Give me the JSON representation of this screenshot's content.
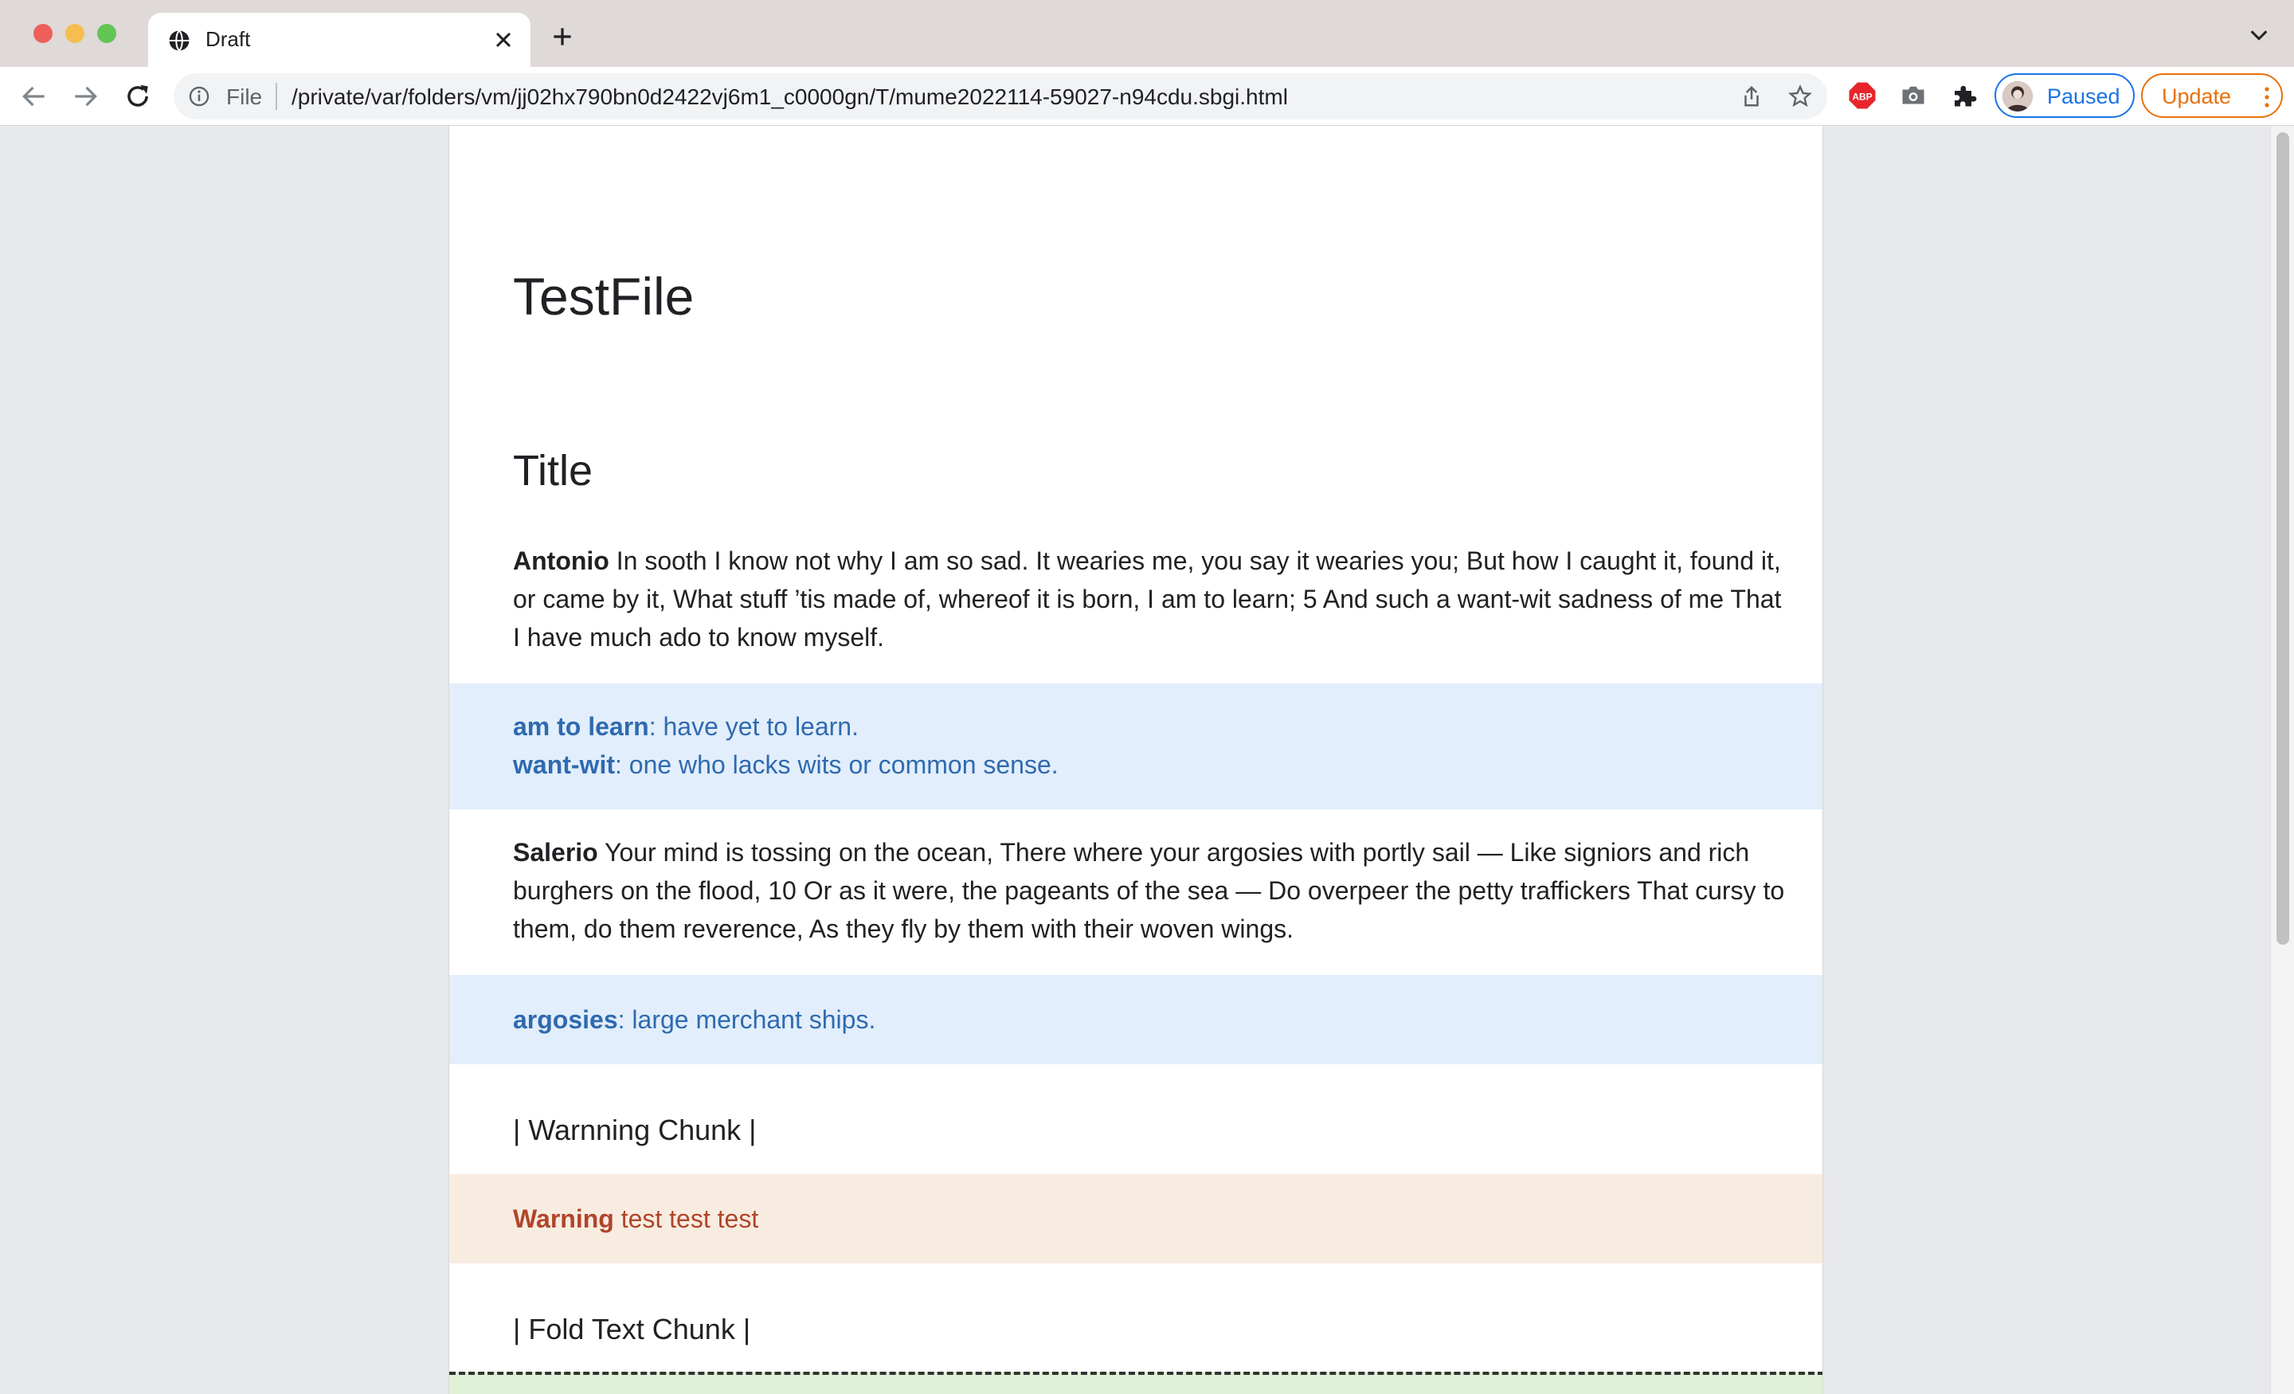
{
  "browser": {
    "tab": {
      "title": "Draft"
    },
    "address": {
      "scheme_label": "File",
      "url": "/private/var/folders/vm/jj02hx790bn0d2422vj6m1_c0000gn/T/mume2022114-59027-n94cdu.sbgi.html"
    },
    "profile": {
      "label": "Paused"
    },
    "update": {
      "label": "Update"
    },
    "extensions": [
      {
        "name": "adblock-icon",
        "badge": "ABP"
      },
      {
        "name": "camera-icon"
      },
      {
        "name": "puzzle-icon"
      }
    ],
    "colors": {
      "tabstrip": "#dfd9d7",
      "accent_blue": "#1a73e8",
      "accent_orange": "#e8710a"
    }
  },
  "document": {
    "title": "TestFile",
    "section_title": "Title",
    "paragraphs": [
      {
        "speaker": "Antonio",
        "text": "In sooth I know not why I am so sad. It wearies me, you say it wearies you; But how I caught it, found it, or came by it, What stuff ’tis made of, whereof it is born, I am to learn; 5 And such a want-wit sadness of me That I have much ado to know myself."
      },
      {
        "speaker": "Salerio",
        "text": "Your mind is tossing on the ocean, There where your argosies with portly sail — Like signiors and rich burghers on the flood, 10 Or as it were, the pageants of the sea — Do overpeer the petty traffickers That cursy to them, do them reverence, As they fly by them with their woven wings."
      }
    ],
    "notes": [
      [
        {
          "term": "am to learn",
          "def": ": have yet to learn."
        },
        {
          "term": "want-wit",
          "def": ": one who lacks wits or common sense."
        }
      ],
      [
        {
          "term": "argosies",
          "def": ": large merchant ships."
        }
      ]
    ],
    "warning_chunk_title": "| Warnning Chunk |",
    "warning": {
      "label": "Warning",
      "text": " test test test"
    },
    "fold_chunk_title": "| Fold Text Chunk |",
    "colors": {
      "note_bg": "#e2eefb",
      "note_text": "#2f6ab0",
      "warn_bg": "#f8ece1",
      "warn_text": "#b0452a",
      "fold_bg": "#dff1d6"
    }
  }
}
